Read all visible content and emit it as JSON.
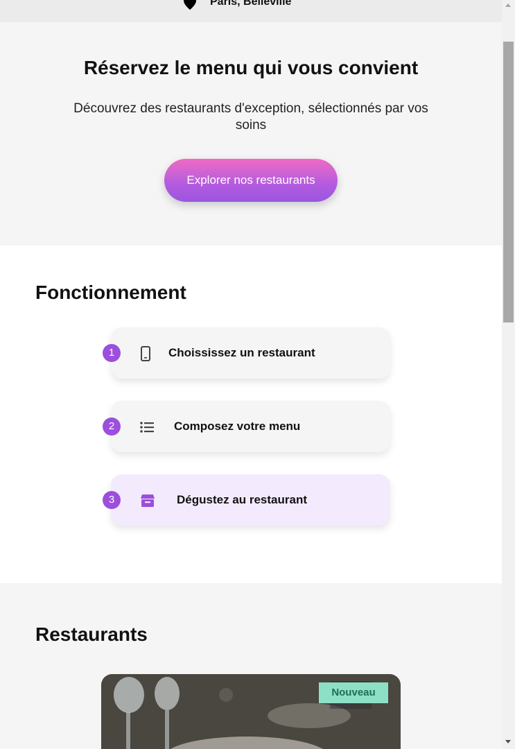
{
  "location": {
    "icon": "map-pin-icon",
    "text": "Paris, Belleville"
  },
  "hero": {
    "title": "Réservez le menu qui vous convient",
    "subtitle": "Découvrez des restaurants d'exception, sélectionnés par vos soins",
    "cta_label": "Explorer nos restaurants"
  },
  "how": {
    "title": "Fonctionnement",
    "steps": [
      {
        "number": "1",
        "icon": "phone-icon",
        "label": "Choississez un restaurant"
      },
      {
        "number": "2",
        "icon": "list-icon",
        "label": "Composez votre menu"
      },
      {
        "number": "3",
        "icon": "store-icon",
        "label": "Dégustez au restaurant"
      }
    ]
  },
  "restaurants": {
    "title": "Restaurants",
    "cards": [
      {
        "badge": "Nouveau"
      }
    ]
  },
  "colors": {
    "accent": "#9b4fdc",
    "cta_gradient_top": "#f06bc4",
    "cta_gradient_bottom": "#9a56de",
    "badge_bg": "#8de0c6",
    "active_step_bg": "#f3eafe"
  }
}
